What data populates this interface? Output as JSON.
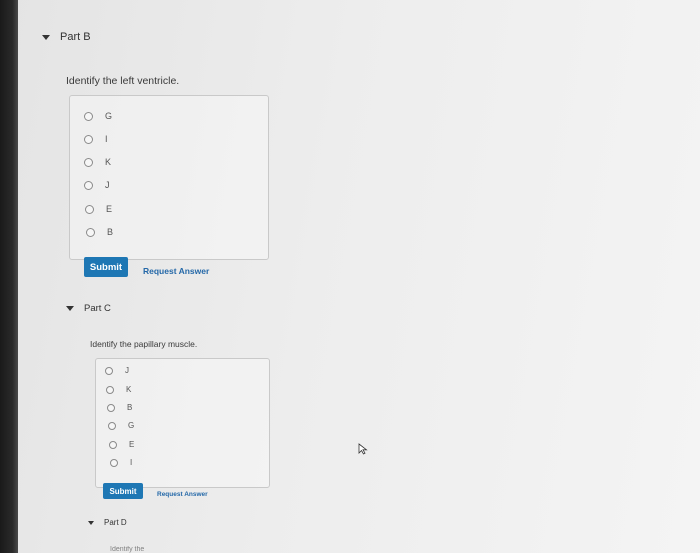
{
  "parts": [
    {
      "header": "Part B",
      "question": "Identify the left ventricle.",
      "options": [
        "G",
        "I",
        "K",
        "J",
        "E",
        "B"
      ],
      "submit_label": "Submit",
      "request_label": "Request Answer"
    },
    {
      "header": "Part C",
      "question": "Identify the papillary muscle.",
      "options": [
        "J",
        "K",
        "B",
        "G",
        "E",
        "I"
      ],
      "submit_label": "Submit",
      "request_label": "Request Answer"
    },
    {
      "header": "Part D",
      "question": "Identify the"
    }
  ],
  "colors": {
    "accent": "#1e77b4",
    "link": "#2468a8"
  },
  "icons": {
    "collapse": "caret-down-icon",
    "cursor": "mouse-pointer-icon"
  }
}
